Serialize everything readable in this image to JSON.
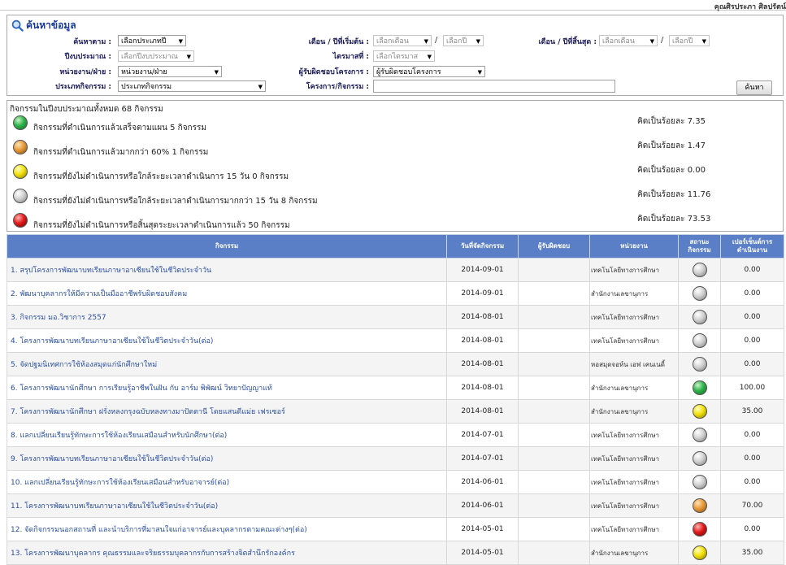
{
  "topbar": {
    "user": "คุณศิรประภา ศิลปรัตน์"
  },
  "search": {
    "title": "ค้นหาข้อมูล",
    "search_by_label": "ค้นหาตาม :",
    "search_by_value": "เลือกประเภทปี",
    "budget_year_label": "ปีงบประมาณ :",
    "budget_year_value": "เลือกปีงบประมาณ",
    "unit_label": "หน่วยงาน/ฝ่าย :",
    "unit_value": "หน่วยงาน/ฝ่าย",
    "activity_type_label": "ประเภทกิจกรรม :",
    "activity_type_value": "ประเภทกิจกรรม",
    "start_label": "เดือน / ปีที่เริ่มต้น :",
    "start_month": "เลือกเดือน",
    "start_year": "เลือกปี",
    "quarter_label": "ไตรมาสที่ :",
    "quarter_value": "เลือกไตรมาส",
    "owner_label": "ผู้รับผิดชอบโครงการ :",
    "owner_value": "ผู้รับผิดชอบโครงการ",
    "project_label": "โครงการ/กิจกรรม :",
    "project_value": "",
    "end_label": "เดือน / ปีที่สิ้นสุด :",
    "end_month": "เลือกเดือน",
    "end_year": "เลือกปี",
    "slash": "/",
    "button": "ค้นหา"
  },
  "summary": {
    "heading": "กิจกรรมในปีงบประมาณทั้งหมด 68 กิจกรรม",
    "rows": [
      {
        "color": "green",
        "text": "กิจกรรมที่ดำเนินการแล้วเสร็จตามแผน 5 กิจกรรม",
        "percent": "คิดเป็นร้อยละ 7.35"
      },
      {
        "color": "orange",
        "text": "กิจกรรมที่ดำเนินการแล้วมากกว่า 60% 1 กิจกรรม",
        "percent": "คิดเป็นร้อยละ 1.47"
      },
      {
        "color": "yellow",
        "text": "กิจกรรมที่ยังไม่ดำเนินการหรือใกล้ระยะเวลาดำเนินการ 15 วัน 0 กิจกรรม",
        "percent": "คิดเป็นร้อยละ 0.00"
      },
      {
        "color": "grey",
        "text": "กิจกรรมที่ยังไม่ดำเนินการหรือใกล้ระยะเวลาดำเนินการมากกว่า 15 วัน 8 กิจกรรม",
        "percent": "คิดเป็นร้อยละ 11.76"
      },
      {
        "color": "red",
        "text": "กิจกรรมที่ยังไม่ดำเนินการหรือสิ้นสุดระยะเวลาดำเนินการแล้ว 50 กิจกรรม",
        "percent": "คิดเป็นร้อยละ 73.53"
      }
    ]
  },
  "table": {
    "headers": {
      "activity": "กิจกรรม",
      "date": "วันที่จัดกิจกรรม",
      "owner": "ผู้รับผิดชอบ",
      "unit": "หน่วยงาน",
      "status": "สถานะ กิจกรรม",
      "percent": "เปอร์เซ็นต์การ ดำเนินงาน"
    },
    "rows": [
      {
        "activity": "1. สรุปโครงการพัฒนาบทเรียนภาษาอาเซียนใช้ในชีวิตประจำวัน",
        "date": "2014-09-01",
        "owner": "",
        "unit": "เทคโนโลยีทางการศึกษา",
        "status": "grey",
        "percent": "0.00"
      },
      {
        "activity": "2. พัฒนาบุคลากรให้มีความเป็นมืออาชีพรับผิดชอบสังคม",
        "date": "2014-09-01",
        "owner": "",
        "unit": "สำนักงานเลขานุการ",
        "status": "grey",
        "percent": "0.00"
      },
      {
        "activity": "3. กิจกรรม มอ.วิชาการ 2557",
        "date": "2014-08-01",
        "owner": "",
        "unit": "เทคโนโลยีทางการศึกษา",
        "status": "grey",
        "percent": "0.00"
      },
      {
        "activity": "4. โครงการพัฒนาบทเรียนภาษาอาเซียนใช้ในชีวิตประจำวัน(ต่อ)",
        "date": "2014-08-01",
        "owner": "",
        "unit": "เทคโนโลยีทางการศึกษา",
        "status": "grey",
        "percent": "0.00"
      },
      {
        "activity": "5. จัดปฐมนิเทศการใช้ห้องสมุดแก่นักศึกษาใหม่",
        "date": "2014-08-01",
        "owner": "",
        "unit": "หอสมุดจอห์น เอฟ เคนเนดี้",
        "status": "grey",
        "percent": "0.00"
      },
      {
        "activity": "6. โครงการพัฒนานักศึกษา การเรียนรู้อาชีพในฝัน กับ อาร์ม พิพัฒน์ วิทยาปัญญาแท้",
        "date": "2014-08-01",
        "owner": "",
        "unit": "สำนักงานเลขานุการ",
        "status": "green",
        "percent": "100.00"
      },
      {
        "activity": "7. โครงการพัฒนานักศึกษา ฝรั่งหลงกรุงฉบับหลงทางมาปัตตานี โดยแสนดีแม่ย เฟรเซอร์",
        "date": "2014-08-01",
        "owner": "",
        "unit": "สำนักงานเลขานุการ",
        "status": "yellow",
        "percent": "35.00"
      },
      {
        "activity": "8. แลกเปลี่ยนเรียนรู้ทักษะการใช้ห้องเรียนเสมือนสำหรับนักศึกษา(ต่อ)",
        "date": "2014-07-01",
        "owner": "",
        "unit": "เทคโนโลยีทางการศึกษา",
        "status": "grey",
        "percent": "0.00"
      },
      {
        "activity": "9. โครงการพัฒนาบทเรียนภาษาอาเซียนใช้ในชีวิตประจำวัน(ต่อ)",
        "date": "2014-07-01",
        "owner": "",
        "unit": "เทคโนโลยีทางการศึกษา",
        "status": "grey",
        "percent": "0.00"
      },
      {
        "activity": "10. แลกเปลี่ยนเรียนรู้ทักษะการใช้ห้องเรียนเสมือนสำหรับอาจารย์(ต่อ)",
        "date": "2014-06-01",
        "owner": "",
        "unit": "เทคโนโลยีทางการศึกษา",
        "status": "grey",
        "percent": "0.00"
      },
      {
        "activity": "11. โครงการพัฒนาบทเรียนภาษาอาเซียนใช้ในชีวิตประจำวัน(ต่อ)",
        "date": "2014-06-01",
        "owner": "",
        "unit": "เทคโนโลยีทางการศึกษา",
        "status": "orange",
        "percent": "70.00"
      },
      {
        "activity": "12. จัดกิจกรรมนอกสถานที่ และนำบริการที่มาสนใจแก่อาจารย์และบุคลากรตามคณะต่างๆ(ต่อ)",
        "date": "2014-05-01",
        "owner": "",
        "unit": "เทคโนโลยีทางการศึกษา",
        "status": "red",
        "percent": "0.00"
      },
      {
        "activity": "13. โครงการพัฒนาบุคลากร คุณธรรมและจริยธรรมบุคลากรกับการสร้างจิตสำนึกรักองค์กร",
        "date": "2014-05-01",
        "owner": "",
        "unit": "สำนักงานเลขานุการ",
        "status": "yellow",
        "percent": "35.00"
      }
    ]
  },
  "status_colors": {
    "green": "#2fb34a",
    "orange": "#e69a3a",
    "yellow": "#f3e20a",
    "grey": "#d2d2d2",
    "red": "#e31b1b"
  },
  "header_color": "#5b7fc6"
}
